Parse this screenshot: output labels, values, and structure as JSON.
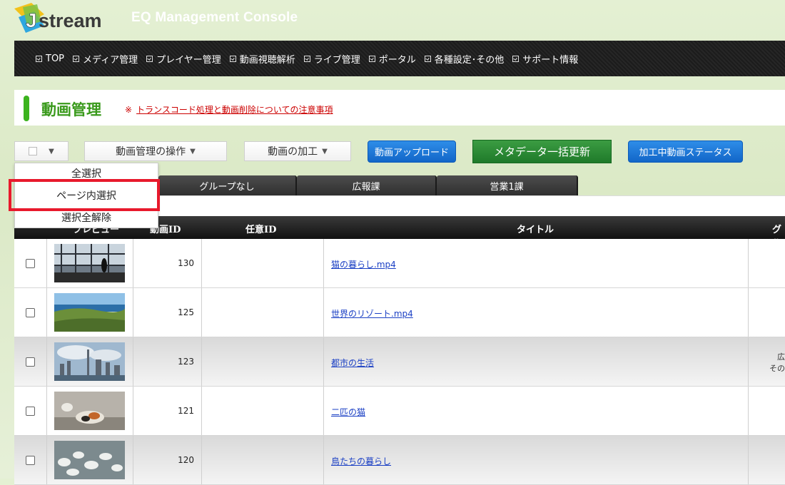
{
  "header": {
    "logo_text": "Jstream",
    "app_title": "EQ Management Console"
  },
  "nav": [
    "TOP",
    "メディア管理",
    "プレイヤー管理",
    "動画視聴解析",
    "ライブ管理",
    "ポータル",
    "各種設定･その他",
    "サポート情報"
  ],
  "page": {
    "title": "動画管理",
    "notice_mark": "※",
    "notice_link": "トランスコード処理と動画削除についての注意事項"
  },
  "toolbar": {
    "ops_label": "動画管理の操作",
    "proc_label": "動画の加工",
    "upload_label": "動画アップロード",
    "metadata_label": "メタデータ一括更新",
    "status_label": "加工中動画ステータス"
  },
  "dropdown": {
    "select_all": "全選択",
    "select_page": "ページ内選択",
    "deselect_all": "選択全解除"
  },
  "tabs": [
    "グループなし",
    "広報課",
    "営業1課"
  ],
  "table": {
    "headers": {
      "preview": "プレビュー",
      "video_id": "動画ID",
      "custom_id": "任意ID",
      "title": "タイトル",
      "group": "グル"
    },
    "rows": [
      {
        "id": "130",
        "title": "猫の暮らし.mp4",
        "group": "",
        "thumb": "airport-icon"
      },
      {
        "id": "125",
        "title": "世界のリゾート.mp4",
        "group": "",
        "thumb": "coast-icon"
      },
      {
        "id": "123",
        "title": "都市の生活",
        "group": "広\nその",
        "thumb": "city-icon"
      },
      {
        "id": "121",
        "title": "二匹の猫",
        "group": "",
        "thumb": "cats-icon"
      },
      {
        "id": "120",
        "title": "鳥たちの暮らし",
        "group": "",
        "thumb": "birds-icon"
      }
    ]
  },
  "colors": {
    "accent_green": "#3cb31e",
    "button_blue": "#1a73d9",
    "button_green": "#2a8a34",
    "highlight_red": "#e8192c"
  }
}
